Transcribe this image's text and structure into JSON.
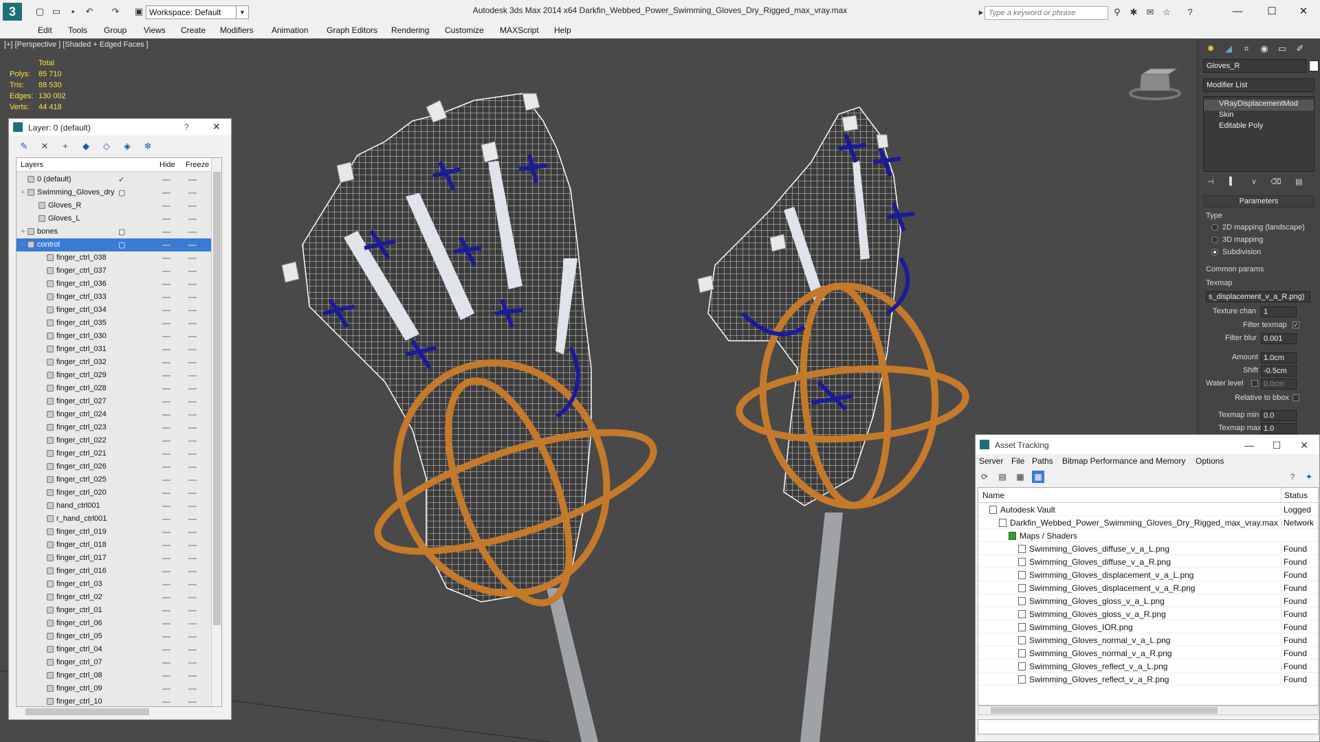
{
  "app": {
    "title": "Autodesk 3ds Max  2014 x64      Darkfin_Webbed_Power_Swimming_Gloves_Dry_Rigged_max_vray.max",
    "workspace": "Workspace: Default",
    "search_placeholder": "Type a keyword or phrase"
  },
  "menu": [
    "Edit",
    "Tools",
    "Group",
    "Views",
    "Create",
    "Modifiers",
    "Animation",
    "Graph Editors",
    "Rendering",
    "Customize",
    "MAXScript",
    "Help"
  ],
  "viewport": {
    "label": "[+] [Perspective ] [Shaded + Edged Faces ]",
    "stats": {
      "header": "Total",
      "rows": [
        {
          "k": "Polys:",
          "v": "85 710"
        },
        {
          "k": "Tris:",
          "v": "88 530"
        },
        {
          "k": "Edges:",
          "v": "130 002"
        },
        {
          "k": "Verts:",
          "v": "44 418"
        }
      ]
    },
    "colors": {
      "bg": "#494949",
      "wire": "#ffffff",
      "ring": "#c47a2a",
      "control": "#1a1a9a"
    }
  },
  "layer_manager": {
    "title": "Layer: 0 (default)",
    "help": "?",
    "columns": {
      "layers": "Layers",
      "hide": "Hide",
      "freeze": "Freeze"
    },
    "rows": [
      {
        "name": "0 (default)",
        "indent": 0,
        "layer": true
      },
      {
        "name": "Swimming_Gloves_dry",
        "indent": 0,
        "layer": true,
        "expand": true
      },
      {
        "name": "Gloves_R",
        "indent": 1
      },
      {
        "name": "Gloves_L",
        "indent": 1
      },
      {
        "name": "bones",
        "indent": 0,
        "layer": true,
        "expand": true
      },
      {
        "name": "control",
        "indent": 0,
        "layer": true,
        "expand": true,
        "selected": true
      },
      {
        "name": "finger_ctrl_038",
        "indent": 2
      },
      {
        "name": "finger_ctrl_037",
        "indent": 2
      },
      {
        "name": "finger_ctrl_036",
        "indent": 2
      },
      {
        "name": "finger_ctrl_033",
        "indent": 2
      },
      {
        "name": "finger_ctrl_034",
        "indent": 2
      },
      {
        "name": "finger_ctrl_035",
        "indent": 2
      },
      {
        "name": "finger_ctrl_030",
        "indent": 2
      },
      {
        "name": "finger_ctrl_031",
        "indent": 2
      },
      {
        "name": "finger_ctrl_032",
        "indent": 2
      },
      {
        "name": "finger_ctrl_029",
        "indent": 2
      },
      {
        "name": "finger_ctrl_028",
        "indent": 2
      },
      {
        "name": "finger_ctrl_027",
        "indent": 2
      },
      {
        "name": "finger_ctrl_024",
        "indent": 2
      },
      {
        "name": "finger_ctrl_023",
        "indent": 2
      },
      {
        "name": "finger_ctrl_022",
        "indent": 2
      },
      {
        "name": "finger_ctrl_021",
        "indent": 2
      },
      {
        "name": "finger_ctrl_026",
        "indent": 2
      },
      {
        "name": "finger_ctrl_025",
        "indent": 2
      },
      {
        "name": "finger_ctrl_020",
        "indent": 2
      },
      {
        "name": "hand_ctrl001",
        "indent": 2
      },
      {
        "name": "r_hand_ctrl001",
        "indent": 2
      },
      {
        "name": "finger_ctrl_019",
        "indent": 2
      },
      {
        "name": "finger_ctrl_018",
        "indent": 2
      },
      {
        "name": "finger_ctrl_017",
        "indent": 2
      },
      {
        "name": "finger_ctrl_016",
        "indent": 2
      },
      {
        "name": "finger_ctrl_03",
        "indent": 2
      },
      {
        "name": "finger_ctrl_02",
        "indent": 2
      },
      {
        "name": "finger_ctrl_01",
        "indent": 2
      },
      {
        "name": "finger_ctrl_06",
        "indent": 2
      },
      {
        "name": "finger_ctrl_05",
        "indent": 2
      },
      {
        "name": "finger_ctrl_04",
        "indent": 2
      },
      {
        "name": "finger_ctrl_07",
        "indent": 2
      },
      {
        "name": "finger_ctrl_08",
        "indent": 2
      },
      {
        "name": "finger_ctrl_09",
        "indent": 2
      },
      {
        "name": "finger_ctrl_10",
        "indent": 2
      }
    ]
  },
  "command_panel": {
    "object_name": "Gloves_R",
    "modifier_list": "Modifier List",
    "stack": [
      "VRayDisplacementMod",
      "Skin",
      "Editable Poly"
    ],
    "parameters": "Parameters",
    "type_label": "Type",
    "type_options": [
      "2D mapping (landscape)",
      "3D mapping",
      "Subdivision"
    ],
    "type_selected": 2,
    "common_params": "Common params",
    "texmap_label": "Texmap",
    "texmap_value": "s_displacement_v_a_R.png)",
    "texture_chan_label": "Texture chan",
    "texture_chan": "1",
    "filter_texmap": "Filter texmap",
    "filter_blur_label": "Filter blur",
    "filter_blur": "0.001",
    "amount_label": "Amount",
    "amount": "1.0cm",
    "shift_label": "Shift",
    "shift": "-0.5cm",
    "water_level_label": "Water level",
    "water_level": "0.0cm",
    "relative_bbox": "Relative to bbox",
    "texmap_min_label": "Texmap min",
    "texmap_min": "0.0",
    "texmap_max_label": "Texmap max",
    "texmap_max": "1.0"
  },
  "asset_tracking": {
    "title": "Asset Tracking",
    "menu": [
      "Server",
      "File",
      "Paths",
      "Bitmap Performance and Memory",
      "Options"
    ],
    "columns": {
      "name": "Name",
      "status": "Status"
    },
    "rows": [
      {
        "name": "Autodesk Vault",
        "status": "Logged",
        "indent": 0
      },
      {
        "name": "Darkfin_Webbed_Power_Swimming_Gloves_Dry_Rigged_max_vray.max",
        "status": "Network",
        "indent": 1
      },
      {
        "name": "Maps / Shaders",
        "status": "",
        "indent": 2
      },
      {
        "name": "Swimming_Gloves_diffuse_v_a_L.png",
        "status": "Found",
        "indent": 3
      },
      {
        "name": "Swimming_Gloves_diffuse_v_a_R.png",
        "status": "Found",
        "indent": 3
      },
      {
        "name": "Swimming_Gloves_displacement_v_a_L.png",
        "status": "Found",
        "indent": 3
      },
      {
        "name": "Swimming_Gloves_displacement_v_a_R.png",
        "status": "Found",
        "indent": 3
      },
      {
        "name": "Swimming_Gloves_gloss_v_a_L.png",
        "status": "Found",
        "indent": 3
      },
      {
        "name": "Swimming_Gloves_gloss_v_a_R.png",
        "status": "Found",
        "indent": 3
      },
      {
        "name": "Swimming_Gloves_IOR.png",
        "status": "Found",
        "indent": 3
      },
      {
        "name": "Swimming_Gloves_normal_v_a_L.png",
        "status": "Found",
        "indent": 3
      },
      {
        "name": "Swimming_Gloves_normal_v_a_R.png",
        "status": "Found",
        "indent": 3
      },
      {
        "name": "Swimming_Gloves_reflect_v_a_L.png",
        "status": "Found",
        "indent": 3
      },
      {
        "name": "Swimming_Gloves_reflect_v_a_R.png",
        "status": "Found",
        "indent": 3
      }
    ]
  }
}
